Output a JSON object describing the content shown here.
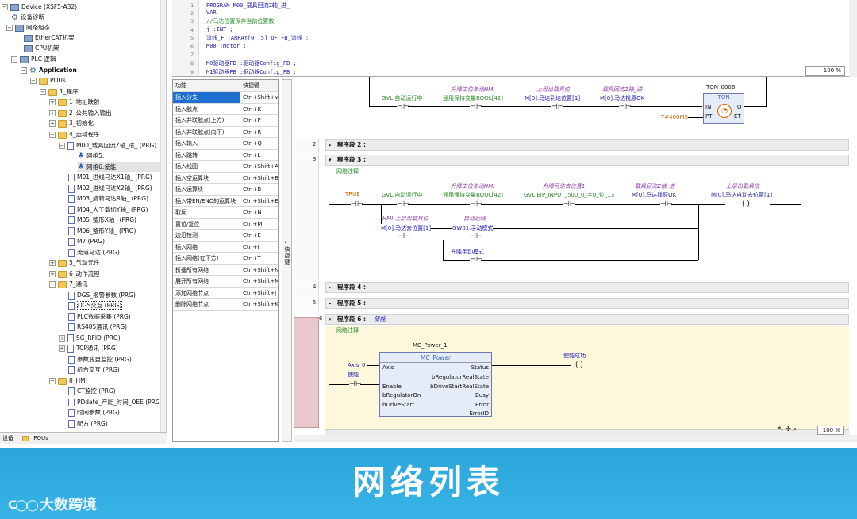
{
  "tree": {
    "device": "Device (XSF5-A32)",
    "items": [
      {
        "label": "设备诊断"
      },
      {
        "label": "网络组态"
      },
      {
        "label": "EtherCAT机架"
      },
      {
        "label": "CPU机架"
      },
      {
        "label": "PLC 逻辑"
      },
      {
        "label": "Application"
      },
      {
        "label": "POUs"
      },
      {
        "label": "1_程序"
      },
      {
        "label": "1_地址映射"
      },
      {
        "label": "2_公共输入输出"
      },
      {
        "label": "3_初始化"
      },
      {
        "label": "4_运动程序"
      },
      {
        "label": "M00_载具回流Z轴_进_ (PRG)"
      },
      {
        "label": "网络5:"
      },
      {
        "label": "网络6:使能"
      },
      {
        "label": "M01_进线马达X1轴_ (PRG)"
      },
      {
        "label": "M02_进线马达X2轴_ (PRG)"
      },
      {
        "label": "M03_旋转马达R轴_ (PRG)"
      },
      {
        "label": "M04_人工载切Y轴_ (PRG)"
      },
      {
        "label": "M05_整形X轴_ (PRG)"
      },
      {
        "label": "M06_整形Y轴_ (PRG)"
      },
      {
        "label": "M7 (PRG)"
      },
      {
        "label": "流道马达 (PRG)"
      },
      {
        "label": "5_气动元件"
      },
      {
        "label": "6_动作流程"
      },
      {
        "label": "7_通讯"
      },
      {
        "label": "DGS_报警参数 (PRG)"
      },
      {
        "label": "DGS交互 (PRG)"
      },
      {
        "label": "PLC数据采集 (PRG)"
      },
      {
        "label": "RS485通讯 (PRG)"
      },
      {
        "label": "SG_RFID (PRG)"
      },
      {
        "label": "TCP通讯 (PRG)"
      },
      {
        "label": "参数变更监控 (PRG)"
      },
      {
        "label": "机台交互 (PRG)"
      },
      {
        "label": "8_HMI"
      },
      {
        "label": "CT监控 (PRG)"
      },
      {
        "label": "PDdate_产能_时间_OEE (PRG)"
      },
      {
        "label": "时间参数 (PRG)"
      },
      {
        "label": "配方 (PRG)"
      }
    ],
    "tab_devices": "设备",
    "tab_pous": "POUs"
  },
  "code": {
    "lines": [
      "PROGRAM M00_载具回流Z轴_进_",
      "VAR",
      "    //马达位置保存当前位置数",
      "    j :INT ;",
      "    流线_F :ARRAY[0..5] OF FB_流线 ;",
      "    M00 :Motor ;",
      "",
      "    M0驱动器FB :驱动器Config_FB ;",
      "    M1驱动器FB :驱动器Config_FB ;"
    ],
    "line_numbers": [
      "1",
      "2",
      "3",
      "4",
      "5",
      "6",
      "7",
      "8",
      "9"
    ],
    "zoom": "100 %"
  },
  "shortcuts": {
    "header_func": "功能",
    "header_key": "快捷键",
    "rows": [
      {
        "f": "插入分支",
        "k": "Ctrl+Shift+V"
      },
      {
        "f": "插入触点",
        "k": "Ctrl+K"
      },
      {
        "f": "插入并联触点(上方)",
        "k": "Ctrl+P"
      },
      {
        "f": "插入并联触点(向下)",
        "k": "Ctrl+R"
      },
      {
        "f": "插入输入",
        "k": "Ctrl+Q"
      },
      {
        "f": "插入跳转",
        "k": "Ctrl+L"
      },
      {
        "f": "插入线圈",
        "k": "Ctrl+Shift+A"
      },
      {
        "f": "插入空运算块",
        "k": "Ctrl+Shift+B"
      },
      {
        "f": "插入运算块",
        "k": "Ctrl+B"
      },
      {
        "f": "插入带EN/ENO的运算块",
        "k": "Ctrl+Shift+E"
      },
      {
        "f": "取反",
        "k": "Ctrl+N"
      },
      {
        "f": "置位/复位",
        "k": "Ctrl+M"
      },
      {
        "f": "边沿检测",
        "k": "Ctrl+E"
      },
      {
        "f": "插入网络",
        "k": "Ctrl+I"
      },
      {
        "f": "插入网络(在下方)",
        "k": "Ctrl+T"
      },
      {
        "f": "折叠所有网络",
        "k": "Ctrl+Shift+N"
      },
      {
        "f": "展开所有网络",
        "k": "Ctrl+Shift+M"
      },
      {
        "f": "添加网络节点",
        "k": "Ctrl+Shift+J"
      },
      {
        "f": "删除网络节点",
        "k": "Ctrl+Shift+K"
      }
    ],
    "side_label": "快捷键"
  },
  "ladder": {
    "seg1": {
      "labels": [
        "GVL.自动运行中",
        "升降工位单动HMI",
        "通用保持变量BOOL[42]",
        "上层出载具位",
        "M[0].马达到达位置[1]",
        "载具回流Z轴_进",
        "M[0].马达找原OK"
      ],
      "timer_name": "TON_0006",
      "timer_type": "TON",
      "timer_pt": "T#400MS",
      "pin_in": "IN",
      "pin_q": "Q",
      "pin_pt": "PT",
      "pin_et": "ET"
    },
    "seg2": {
      "num": "2",
      "label": "程序段 2 :"
    },
    "seg3": {
      "num": "3",
      "label": "程序段 3 :",
      "comment": "网络注释",
      "labels": [
        "TRUE",
        "GVL.自动运行中",
        "升降工位单动HMI",
        "通用保持变量BOOL[42]",
        "升降马达去位置1",
        "GVL.EIP_INPUT_500_0_字0_位_13",
        "载具回流Z轴_进",
        "M[0].马达找原OK",
        "上层出载具位",
        "M[0].马达自动去位置[1]",
        "HMI:上层出载具位",
        "M[0].马达去位置[1]",
        "自动运线",
        "GW01.手动模式",
        "升降手动模式"
      ]
    },
    "seg4": {
      "num": "4",
      "label": "程序段 4 :"
    },
    "seg5": {
      "num": "5",
      "label": "程序段 5 :"
    },
    "seg6": {
      "num": "6",
      "label": "程序段 6 :",
      "title": "使能",
      "comment": "网络注释",
      "fb_name": "MC_Power_1",
      "fb_type": "MC_Power",
      "in_axis": "Axis",
      "in_enable": "Enable",
      "in_reg": "bRegulatorOn",
      "in_drive": "bDriveStart",
      "out_status": "Status",
      "out_regrs": "bRegulatorRealState",
      "out_drs": "bDriveStartRealState",
      "out_busy": "Busy",
      "out_error": "Error",
      "out_errid": "ErrorID",
      "axis_var": "Axis_0",
      "enable_var": "使能",
      "coil_var": "使能成功"
    },
    "zoom": "100 %"
  },
  "banner": {
    "title": "网络列表",
    "logo": "大数跨境"
  }
}
